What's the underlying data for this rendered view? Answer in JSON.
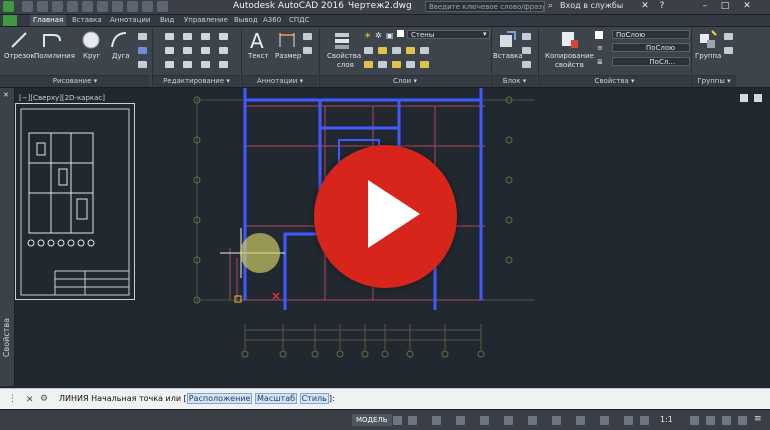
{
  "titlebar": {
    "app_title": "Autodesk AutoCAD 2016",
    "doc_title": "Чертеж2.dwg",
    "search_placeholder": "Введите ключевое слово/фразу",
    "signin": "Вход в службы"
  },
  "tabs": [
    {
      "label": "Главная",
      "active": true
    },
    {
      "label": "Вставка"
    },
    {
      "label": "Аннотации"
    },
    {
      "label": "Вид"
    },
    {
      "label": "Управление"
    },
    {
      "label": "Вывод"
    },
    {
      "label": "A360"
    },
    {
      "label": "СПДС"
    }
  ],
  "ribbon": {
    "draw": {
      "title": "Рисование ▾",
      "line": "Отрезок",
      "polyline": "Полилиния",
      "circle": "Круг",
      "arc": "Дуга"
    },
    "modify": {
      "title": "Редактирование ▾"
    },
    "annotation": {
      "title": "Аннотации ▾",
      "text": "Текст",
      "dimension": "Размер"
    },
    "layers": {
      "title": "Слои ▾",
      "layer_props": "Свойства",
      "layer_props2": "слоя",
      "current_layer": "Стены"
    },
    "block": {
      "title": "Блок ▾",
      "insert": "Вставка"
    },
    "properties": {
      "title": "Свойства ▾",
      "match": "Копирование",
      "match2": "свойств",
      "color": "ПоСлою",
      "linetype": "ПоСлою",
      "lineweight": "ПоСл..."
    },
    "groups": {
      "title": "Группы ▾",
      "group": "Группа"
    }
  },
  "viewport": {
    "label": "[−][Сверху][2D-каркас]"
  },
  "palette": {
    "label": "Свойства"
  },
  "command": {
    "prefix": "ЛИНИЯ Начальная точка или",
    "opt1": "Расположение",
    "opt2": "Масштаб",
    "opt3": "Стиль",
    "suffix": "]:"
  },
  "status": {
    "model_tab": "МОДЕЛЬ",
    "scale": "1:1"
  },
  "colors": {
    "accent": "#d7251c",
    "wall_blue": "#3f5bff",
    "canvas_bg": "#212830"
  }
}
